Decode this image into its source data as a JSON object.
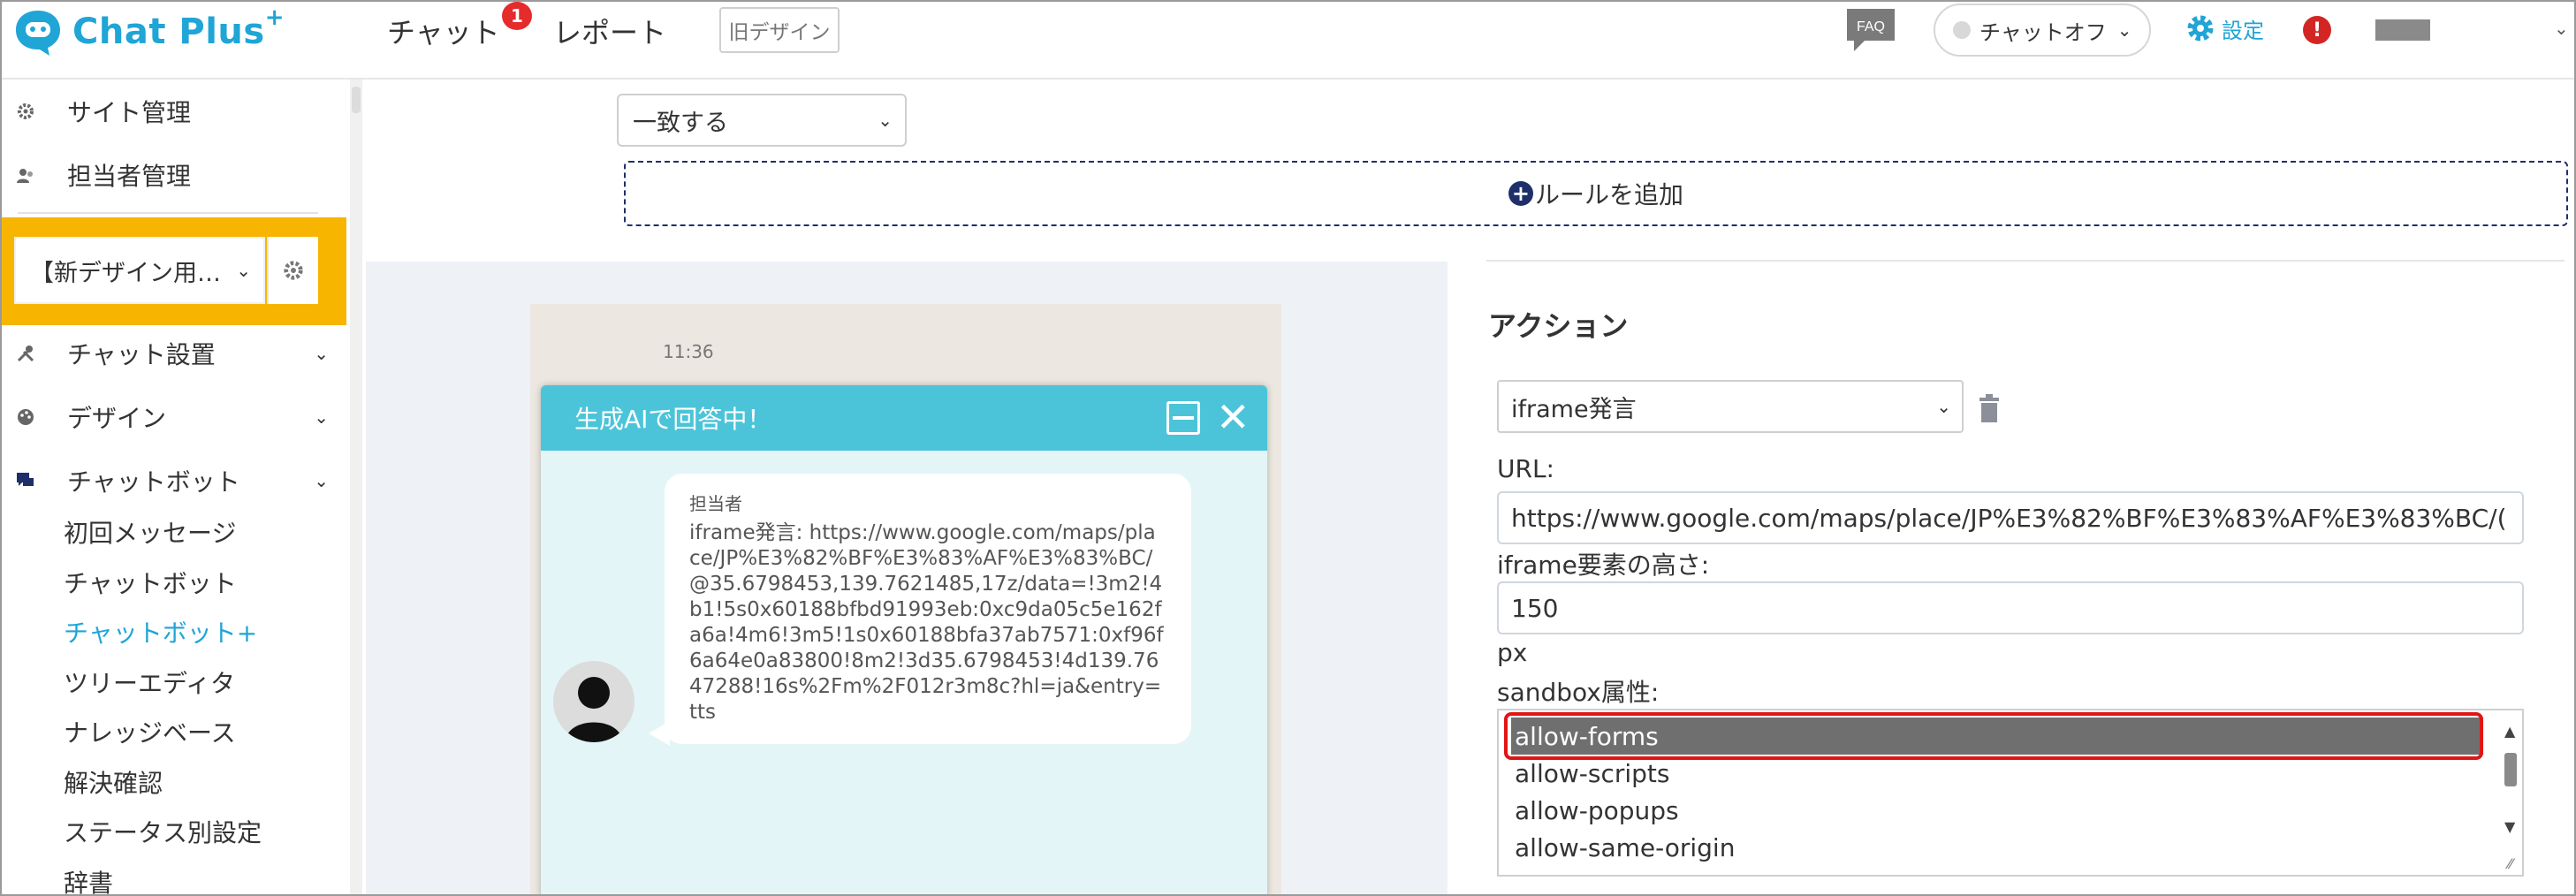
{
  "header": {
    "logo_text": "Chat Plus",
    "logo_plus": "+",
    "nav_chat": "チャット",
    "nav_chat_badge": "1",
    "nav_report": "レポート",
    "old_design": "旧デザイン",
    "faq": "FAQ",
    "chat_status": "チャットオフ",
    "settings": "設定",
    "alert": "!"
  },
  "sidebar": {
    "site_admin": "サイト管理",
    "staff_admin": "担当者管理",
    "site_select": "【新デザイン用…",
    "chat_settings": "チャット設置",
    "design": "デザイン",
    "chatbot": "チャットボット",
    "sub_items": [
      "初回メッセージ",
      "チャットボット",
      "チャットボット+",
      "ツリーエディタ",
      "ナレッジベース",
      "解決確認",
      "ステータス別設定",
      "辞書"
    ]
  },
  "rules": {
    "match_select": "一致する",
    "add_rule": "ルールを追加"
  },
  "preview": {
    "chat_title": "生成AIで回答中！",
    "sender": "担当者",
    "message": "iframe発言: https://www.google.com/maps/place/JP%E3%82%BF%E3%83%AF%E3%83%BC/@35.6798453,139.7621485,17z/data=!3m2!4b1!5s0x60188bfbd91993eb:0xc9da05c5e162fa6a!4m6!3m5!1s0x60188bfa37ab7571:0xf96f6a64e0a83800!8m2!3d35.6798453!4d139.7647288!16s%2Fm%2F012r3m8c?hl=ja&entry=tts",
    "time": "11:36"
  },
  "action": {
    "title": "アクション",
    "type_select": "iframe発言",
    "url_label": "URL:",
    "url_value": "https://www.google.com/maps/place/JP%E3%82%BF%E3%83%AF%E3%83%BC/(",
    "height_label": "iframe要素の高さ:",
    "height_value": "150",
    "height_unit": "px",
    "sandbox_label": "sandbox属性:",
    "sandbox_options": [
      "allow-forms",
      "allow-scripts",
      "allow-popups",
      "allow-same-origin"
    ],
    "sandbox_selected": "allow-forms"
  },
  "colors": {
    "brand": "#1fa5d6",
    "highlight_site": "#f7b500",
    "chat_header": "#4bc4d9",
    "selected_outline": "#e01515"
  }
}
